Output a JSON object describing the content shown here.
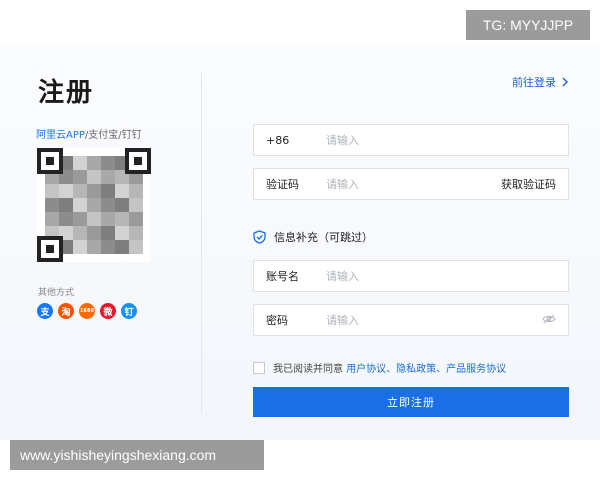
{
  "badge": "TG: MYYJJPP",
  "watermark": "www.yishisheyingshexiang.com",
  "title": "注册",
  "scan": {
    "apps": "阿里云APP",
    "rest": "/支付宝/钉钉"
  },
  "other_methods": "其他方式",
  "social": [
    {
      "icon": "alipay-icon",
      "glyph": "支",
      "color": "#1677ff"
    },
    {
      "icon": "taobao-icon",
      "glyph": "淘",
      "color": "#ff5000"
    },
    {
      "icon": "1688-icon",
      "glyph": "1688",
      "color": "#ff6a00"
    },
    {
      "icon": "weibo-icon",
      "glyph": "微",
      "color": "#e6162d"
    },
    {
      "icon": "dingtalk-icon",
      "glyph": "钉",
      "color": "#1890ff"
    }
  ],
  "login_link": "前往登录",
  "phone": {
    "prefix": "+86",
    "placeholder": "请输入"
  },
  "code": {
    "label": "验证码",
    "placeholder": "请输入",
    "action": "获取验证码"
  },
  "info_title": "信息补充（可跳过）",
  "account": {
    "label": "账号名",
    "placeholder": "请输入"
  },
  "password": {
    "label": "密码",
    "placeholder": "请输入"
  },
  "agreement": {
    "text": "我已阅读并同意",
    "links": "用户协议、隐私政策、产品服务协议"
  },
  "submit_label": "立即注册",
  "colors": {
    "primary": "#1a6fe6",
    "link": "#1a5fc8",
    "watermark_bg": "#9b9b9b"
  }
}
